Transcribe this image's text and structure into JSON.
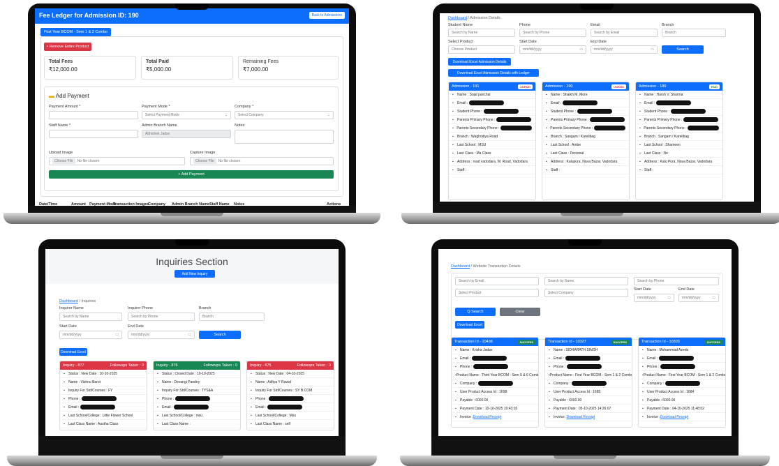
{
  "ledger": {
    "title": "Fee Ledger for Admission ID: 190",
    "back_label": "Back to Admissions",
    "product_tab": "First Year BCOM - Sem 1 & 2 Combo",
    "remove_label": "Remove Entire Product",
    "total_fees_label": "Total Fees",
    "total_fees": "₹12,000.00",
    "total_paid_label": "Total Paid",
    "total_paid": "₹5,000.00",
    "remaining_label": "Remaining Fees",
    "remaining": "₹7,000.00",
    "add_payment_title": "Add Payment",
    "payment_amount_label": "Payment Amount *",
    "payment_mode_label": "Payment Mode *",
    "payment_mode_value": "Select Payment Mode",
    "company_label": "Company *",
    "company_value": "Select Company",
    "staff_name_label": "Staff Name *",
    "admin_branch_label": "Admin Branch Name",
    "admin_branch_value": "Abhishek Jadav",
    "notes_label": "Notes",
    "upload_image_label": "Upload Image",
    "capture_image_label": "Capture Image",
    "choose_file": "Choose File",
    "no_file": "No file chosen",
    "add_payment_button": "+ Add Payment",
    "columns": [
      "Date/Time",
      "Amount",
      "Payment Mode",
      "Transaction Images",
      "Company",
      "Admin Branch Name",
      "Staff Name",
      "Notes",
      "Actions"
    ]
  },
  "admissions": {
    "breadcrumb_home": "Dashboard",
    "breadcrumb_current": " / Admission Details",
    "student_name_label": "Student Name",
    "student_name_placeholder": "Search by Name",
    "phone_label": "Phone",
    "phone_placeholder": "Search by Phone",
    "email_label": "Email",
    "email_placeholder": "Search by Email",
    "branch_label": "Branch",
    "branch_placeholder": "Branch",
    "select_product_label": "Select Product",
    "select_product_value": "Choose Product",
    "start_date_label": "Start Date",
    "end_date_label": "End Date",
    "date_placeholder": "mm/dd/yyyy",
    "search_button": "Search",
    "download_excel": "Download Excel Admission Details",
    "download_excel_ledger": "Download Excel Admission Details with Ledger",
    "cards": [
      {
        "title": "Admission - 191",
        "badge": "UNPAID",
        "badge_color": "#dc3545",
        "rows": [
          "Name : Sojal panchal",
          "Email :",
          "Student Phone :",
          "Parents Primary Phone :",
          "Parents Secondary Phone :",
          "Branch : Waghodiya Road",
          "Last School : MSU",
          "Last Class : Ma Class",
          "Address : road vadodara, W. Road, Vadodara",
          "Staff :"
        ]
      },
      {
        "title": "Admission - 190",
        "badge": "UNPAID",
        "badge_color": "#dc3545",
        "rows": [
          "Name : Shaikh M. More",
          "Email :",
          "Student Phone :",
          "Parents Primary Phone :",
          "Parents Secondary Phone :",
          "Branch : Sangam / Karelibag",
          "Last School : Ambe",
          "Last Class : Personal",
          "Address : Kalupura, Nava Bazar, Vadodara",
          "Staff :"
        ]
      },
      {
        "title": "Admission - 189",
        "badge": "PAID",
        "badge_color": "#198754",
        "rows": [
          "Name : Harsh V. Sharma",
          "Email :",
          "Student Phone :",
          "Parents Primary Phone :",
          "Parents Secondary Phone :",
          "Branch : Sangam / Karelibag",
          "Last School : Shameen",
          "Last Class : No",
          "Address : Kalu Pura, Nava Bazar, Vadodara",
          "Staff :"
        ]
      }
    ]
  },
  "inquiries": {
    "title": "Inquiries Section",
    "add_button": "Add New Inquiry",
    "breadcrumb_home": "Dashboard",
    "breadcrumb_current": " / Inquiries",
    "inquirer_name_label": "Inquirer Name",
    "inquirer_name_placeholder": "Search by Name",
    "inquirer_phone_label": "Inquirer Phone",
    "inquirer_phone_placeholder": "Search by Phone",
    "branch_label": "Branch",
    "branch_placeholder": "Branch",
    "start_date_label": "Start Date",
    "end_date_label": "End Date",
    "date_placeholder": "mm/dd/yyyy",
    "search_button": "Search",
    "download_excel": "Download Excel",
    "cards": [
      {
        "title": "Inquiry - 877",
        "followups": "Followups Taken : 0",
        "color": "#dc3545",
        "rows": [
          "Status : New   Date : 10-10-2025",
          "Name : Vishnu Barot",
          "Inquiry For Std/Courses : FY",
          "Phone :",
          "Email :",
          "Last School/College : Little Flower School",
          "Last Class Name : Aastha Class"
        ]
      },
      {
        "title": "Inquiry - 876",
        "followups": "Followups Taken : 0",
        "color": "#198754",
        "rows": [
          "Status : Closed   Date : 10-10-2025",
          "Name : Devangi Pandey",
          "Inquiry For Std/Courses : TYS&A",
          "Phone :",
          "Email :",
          "Last School/College : msu",
          "Last Class Name :"
        ]
      },
      {
        "title": "Inquiry - 875",
        "followups": "Followups Taken : 0",
        "color": "#dc3545",
        "rows": [
          "Status : New   Date : 04-10-2025",
          "Name : Aditya Y Rawal",
          "Inquiry For Std/Courses : SY B.COM",
          "Phone :",
          "Email :",
          "Last School/College : Msu",
          "Last Class Name : self"
        ]
      }
    ]
  },
  "transactions": {
    "breadcrumb_home": "Dashboard",
    "breadcrumb_current": " / Website Transaction Details",
    "email_placeholder": "Search by Email",
    "name_placeholder": "Search by Name",
    "phone_placeholder": "Search by Phone",
    "product_value": "Select Product",
    "company_value": "Select Company",
    "start_date_label": "Start Date",
    "end_date_label": "End Date",
    "date_placeholder": "mm/dd/yyyy",
    "search_button": "Q Search",
    "clear_button": "Clear",
    "download_excel": "Download Excel",
    "cards": [
      {
        "title": "Transaction Id - 10438",
        "badge": "SUCCESS",
        "rows": [
          "Name : Krisha Jadav",
          "Email :",
          "Phone :",
          "Product Name : Third Year BCOM - Sem 5 & 6 Combo",
          "Company :",
          "User Product Access Id : 1698",
          "Payable : 6000.00",
          "Payment Date : 10-10-2025 10:43:02",
          "Invoice : Download Receipt"
        ]
      },
      {
        "title": "Transaction Id - 10327",
        "badge": "SUCCESS",
        "rows": [
          "Name : SIDHARATH SINGH",
          "Email :",
          "Phone :",
          "Product Name : First Year BCOM - Sem 1 & 2 Combo",
          "Company :",
          "User Product Access Id : 1685",
          "Payable : 6000.00",
          "Payment Date : 05-10-2025 14:26:07",
          "Invoice : Download Receipt"
        ]
      },
      {
        "title": "Transaction Id - 10303",
        "badge": "SUCCESS",
        "rows": [
          "Name : Mohammad Azeeb",
          "Email :",
          "Phone :",
          "Product Name : First Year BCOM - Sem 1 & 2 Combo",
          "Company :",
          "User Product Access Id : 1684",
          "Payable : 6000.00",
          "Payment Date : 04-10-2025 11:48:52",
          "Invoice : Download Receipt"
        ]
      }
    ]
  }
}
